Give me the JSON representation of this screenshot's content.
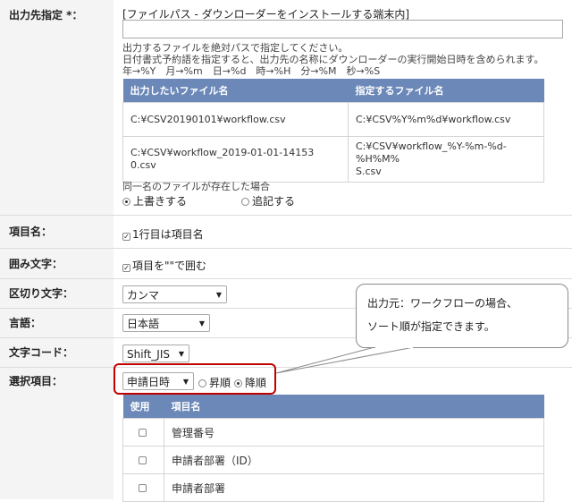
{
  "output_dest": {
    "label": "出力先指定 *：",
    "heading": "[ファイルパス - ダウンローダーをインストールする端末内]",
    "input_value": "",
    "help1": "出力するファイルを絶対パスで指定してください。",
    "help2": "日付書式予約語を指定すると、出力先の名称にダウンローダーの実行開始日時を含められます。",
    "help3": "年→%Y　月→%m　日→%d　時→%H　分→%M　秒→%S",
    "table_headers": [
      "出力したいファイル名",
      "指定するファイル名"
    ],
    "table_rows": [
      [
        "C:¥CSV20190101¥workflow.csv",
        "C:¥CSV%Y%m%d¥workflow.csv"
      ],
      [
        "C:¥CSV¥workflow_2019-01-01-14153\n0.csv",
        "C:¥CSV¥workflow_%Y-%m-%d-%H%M%\nS.csv"
      ]
    ],
    "exist_label": "同一名のファイルが存在した場合",
    "overwrite": "上書きする",
    "append": "追記する"
  },
  "item_name": {
    "label": "項目名：",
    "checkbox": "1行目は項目名"
  },
  "enclosure": {
    "label": "囲み文字：",
    "checkbox": "項目を\"\"で囲む"
  },
  "delimiter": {
    "label": "区切り文字：",
    "value": "カンマ"
  },
  "language": {
    "label": "言語：",
    "value": "日本語"
  },
  "charset": {
    "label": "文字コード：",
    "value": "Shift_JIS"
  },
  "selection": {
    "label": "選択項目：",
    "sort_value": "申請日時",
    "asc": "昇順",
    "desc": "降順",
    "headers": [
      "使用",
      "項目名"
    ],
    "items": [
      "管理番号",
      "申請者部署（ID）",
      "申請者部署"
    ]
  },
  "callout": {
    "line1": "出力元：ワークフローの場合、",
    "line2": "ソート順が指定できます。"
  },
  "colors": {
    "table_header": "#6b88b8",
    "highlight": "#c00000",
    "label_bg": "#f4f4f4"
  }
}
